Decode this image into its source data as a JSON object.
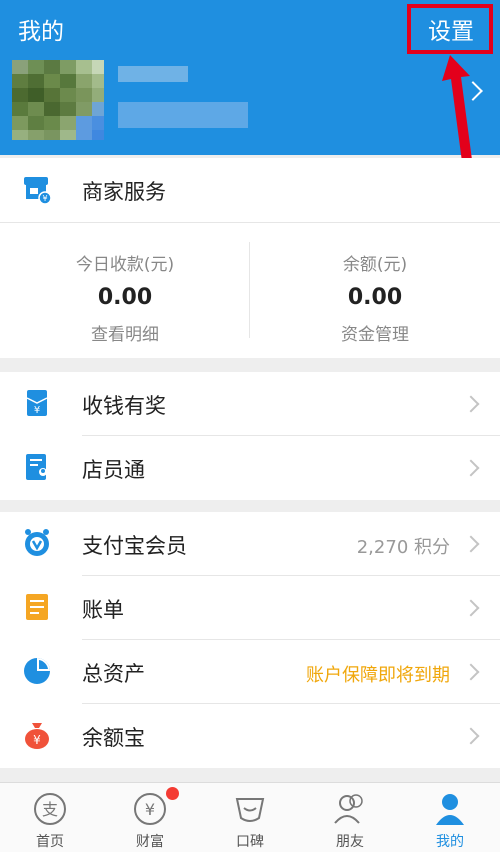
{
  "header": {
    "title": "我的",
    "settings_label": "设置"
  },
  "merchant": {
    "label": "商家服务"
  },
  "stats": {
    "left": {
      "caption": "今日收款(元)",
      "value": "0.00",
      "link": "查看明细"
    },
    "right": {
      "caption": "余额(元)",
      "value": "0.00",
      "link": "资金管理"
    }
  },
  "group1": [
    {
      "label": "收钱有奖",
      "icon": "red-envelope-yuan-icon"
    },
    {
      "label": "店员通",
      "icon": "staff-card-icon"
    }
  ],
  "group2": [
    {
      "label": "支付宝会员",
      "icon": "member-badge-icon",
      "right": "2,270 积分"
    },
    {
      "label": "账单",
      "icon": "bill-icon"
    },
    {
      "label": "总资产",
      "icon": "pie-chart-icon",
      "right": "账户保障即将到期"
    },
    {
      "label": "余额宝",
      "icon": "money-bag-icon"
    }
  ],
  "tabs": [
    {
      "label": "首页",
      "icon": "home-alipay-icon"
    },
    {
      "label": "财富",
      "icon": "wealth-yuan-icon"
    },
    {
      "label": "口碑",
      "icon": "koubei-icon"
    },
    {
      "label": "朋友",
      "icon": "friends-icon"
    },
    {
      "label": "我的",
      "icon": "profile-icon"
    }
  ],
  "colors": {
    "header_blue": "#1f8fe0",
    "annotation_red": "#e3001b",
    "orange_text": "#f0a70c",
    "badge_red": "#f43b33"
  }
}
